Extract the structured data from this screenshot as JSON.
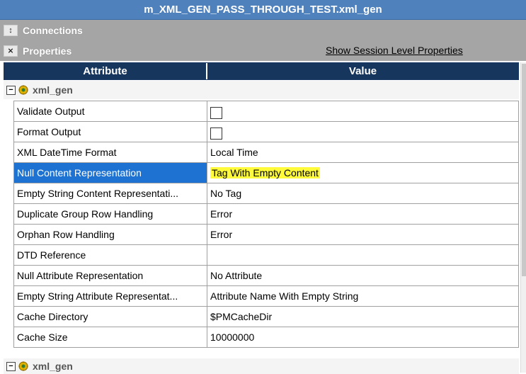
{
  "window": {
    "title": "m_XML_GEN_PASS_THROUGH_TEST.xml_gen"
  },
  "sections": {
    "connections": {
      "label": "Connections",
      "toggle_icon": "up-down-arrow-icon"
    },
    "properties": {
      "label": "Properties",
      "toggle_icon": "collapse-arrow-icon",
      "link": "Show Session Level Properties"
    }
  },
  "grid": {
    "header": {
      "attribute": "Attribute",
      "value": "Value"
    },
    "group": {
      "name": "xml_gen",
      "expander": "−",
      "icon": "transformation-gear-icon"
    },
    "rows": [
      {
        "attribute": "Validate Output",
        "value": "",
        "checkbox": true,
        "checked": false
      },
      {
        "attribute": "Format Output",
        "value": "",
        "checkbox": true,
        "checked": false
      },
      {
        "attribute": "XML DateTime Format",
        "value": "Local Time"
      },
      {
        "attribute": "Null Content Representation",
        "value": "Tag With Empty Content",
        "selected": true,
        "highlight_color": "#fffb3a"
      },
      {
        "attribute": "Empty String Content Representati...",
        "value": "No Tag"
      },
      {
        "attribute": "Duplicate Group Row Handling",
        "value": "Error"
      },
      {
        "attribute": "Orphan Row Handling",
        "value": "Error"
      },
      {
        "attribute": "DTD Reference",
        "value": ""
      },
      {
        "attribute": "Null Attribute Representation",
        "value": "No Attribute"
      },
      {
        "attribute": "Empty String Attribute Representat...",
        "value": "Attribute Name With Empty String"
      },
      {
        "attribute": "Cache Directory",
        "value": "$PMCacheDir"
      },
      {
        "attribute": "Cache Size",
        "value": "10000000"
      }
    ],
    "group2": {
      "name": "xml_gen",
      "expander": "−",
      "icon": "transformation-gear-icon"
    }
  },
  "colors": {
    "title_bar": "#4f81bd",
    "section_bar": "#a5a5a5",
    "header": "#17365d",
    "selection": "#1e73d2",
    "highlight": "#fffb3a"
  }
}
